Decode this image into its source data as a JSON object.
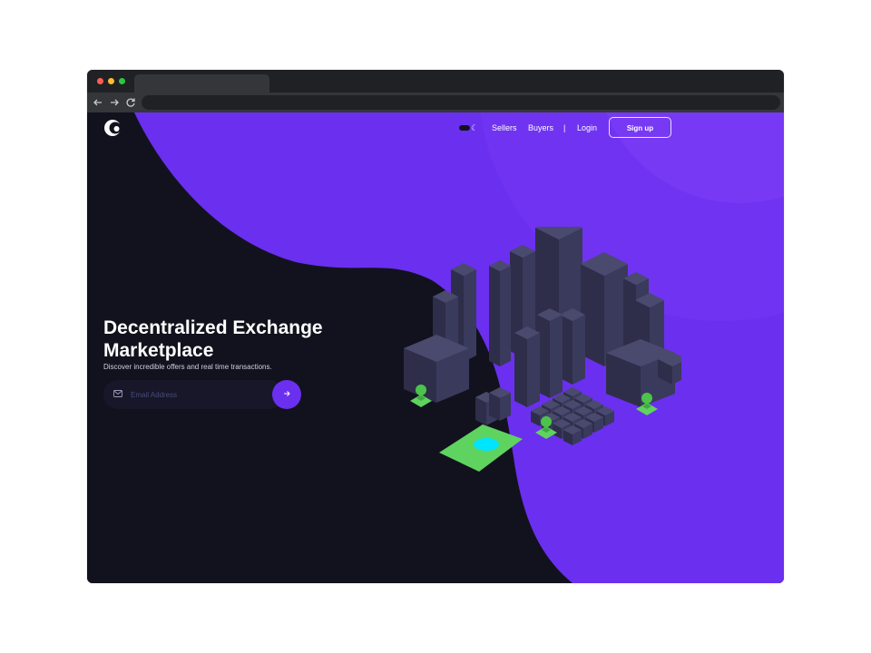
{
  "browser": {
    "traffic_lights": {
      "close": "#ff5f57",
      "minimize": "#febc2e",
      "maximize": "#28c840"
    },
    "back_icon": "arrow-left",
    "forward_icon": "arrow-right",
    "reload_icon": "reload",
    "address": ""
  },
  "theme": {
    "accent": "#6b2ff0",
    "dark_bg": "#12121e",
    "grass": "#5fd35f",
    "water": "#00e5ff",
    "building": "#3a3a5c"
  },
  "nav": {
    "logo": "brand-logo",
    "theme_toggle_icon": "moon-icon",
    "sellers": "Sellers",
    "buyers": "Buyers",
    "divider": "|",
    "login": "Login",
    "signup": "Sign up"
  },
  "hero": {
    "title": "Decentralized Exchange Marketplace",
    "subtitle": "Discover incredible offers and real time transactions.",
    "email_placeholder": "Email Address",
    "email_value": "",
    "submit_icon": "arrow-right-icon"
  }
}
